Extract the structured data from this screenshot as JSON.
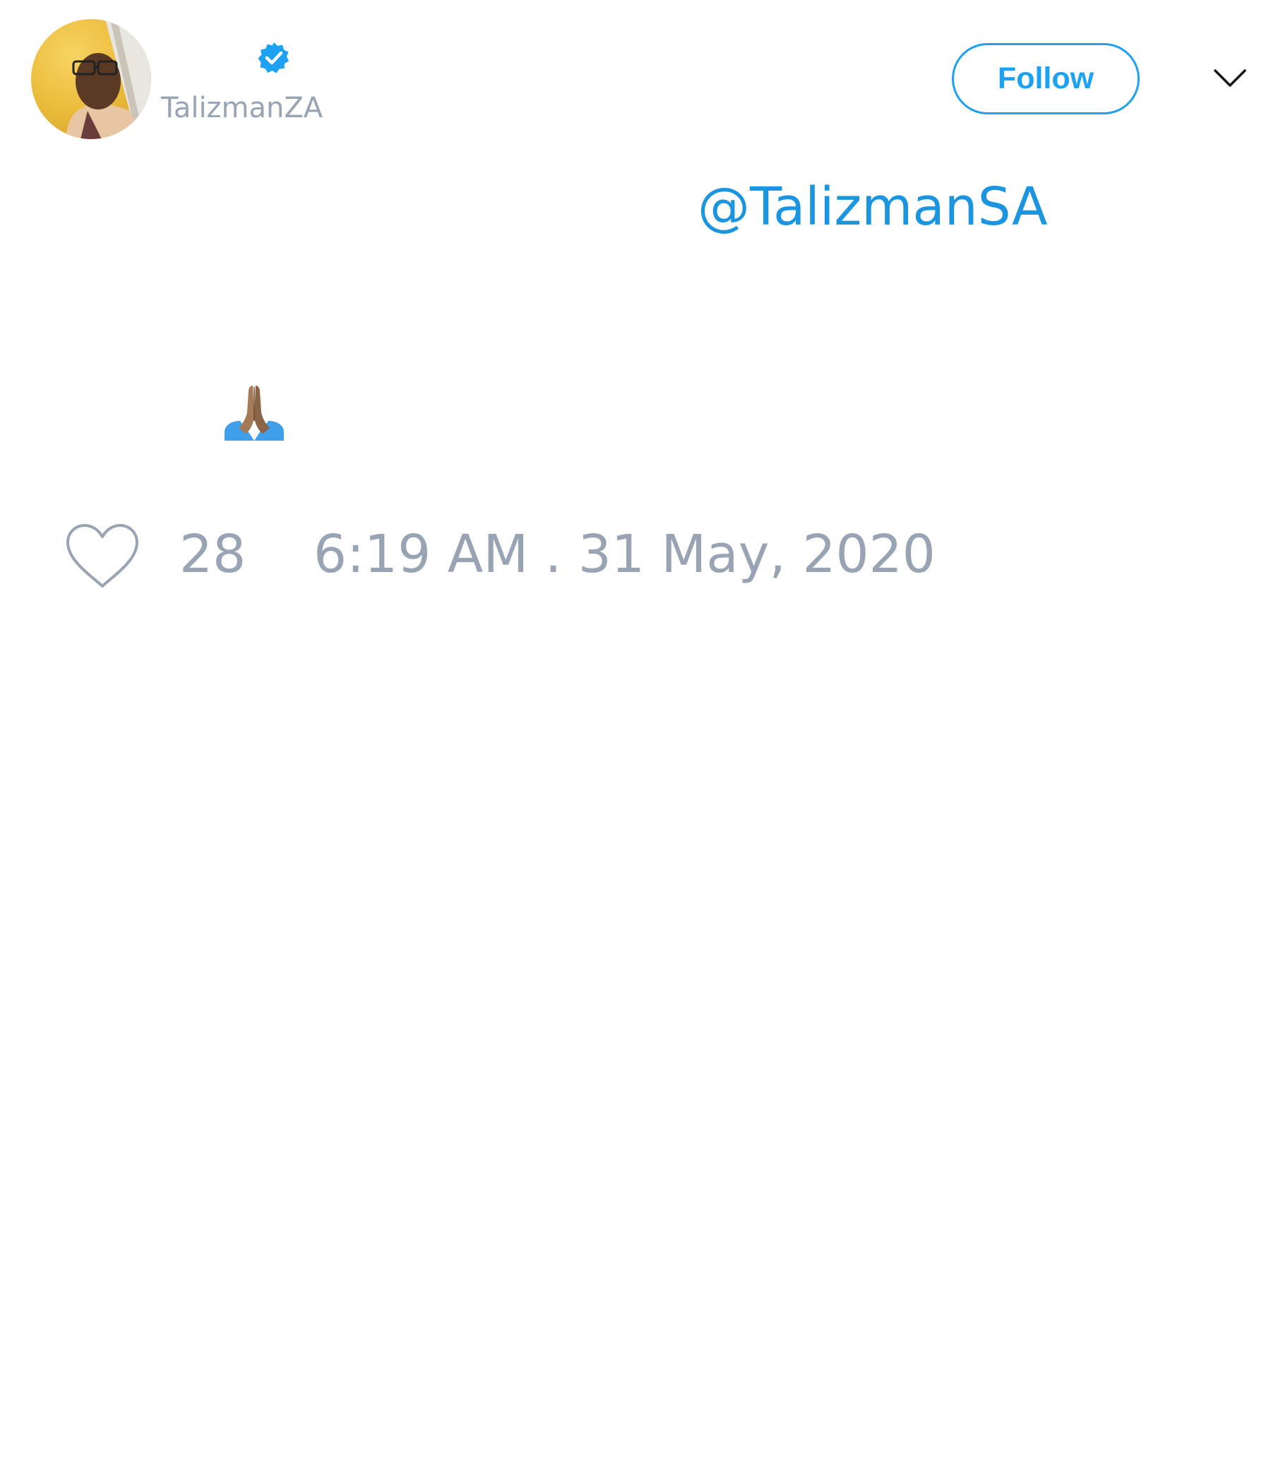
{
  "tweet": {
    "author": {
      "display_name": "",
      "handle": "TalizmanZA",
      "verified": true,
      "avatar_icon": "user-photo-avatar"
    },
    "follow_label": "Follow",
    "menu_icon": "chevron-down-icon",
    "mention": "@TalizmanSA",
    "emoji_icon": "folded-hands-emoji",
    "likes": "28",
    "timestamp": "6:19 AM . 31 May, 2020"
  },
  "colors": {
    "accent": "#1da1f2",
    "link": "#1b95e0",
    "muted": "#98a4b3",
    "background": "#ffffff"
  }
}
